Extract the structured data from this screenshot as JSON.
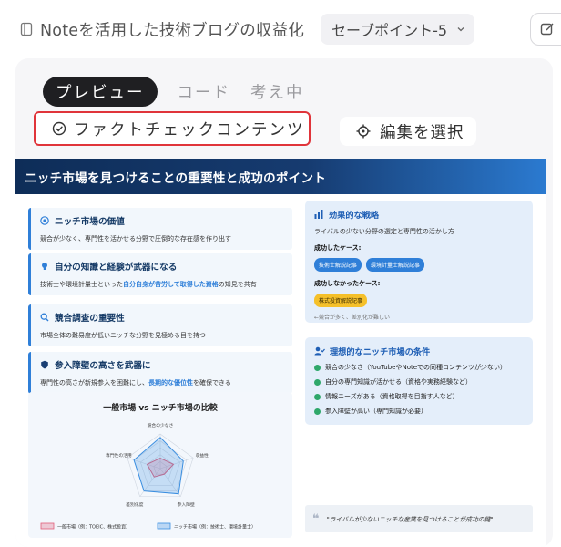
{
  "topbar": {
    "doc_title": "Noteを活用した技術ブログの収益化",
    "save_point": "セーブポイント-5"
  },
  "tabs": [
    {
      "label": "プレビュー",
      "active": true
    },
    {
      "label": "コード",
      "active": false
    },
    {
      "label": "考え中",
      "active": false
    }
  ],
  "actions": {
    "fact_check": "ファクトチェックコンテンツ",
    "select_edit": "編集を選択"
  },
  "slide": {
    "title": "ニッチ市場を見つけることの重要性と成功のポイント",
    "cards": [
      {
        "title": "ニッチ市場の価値",
        "text": "競合が少なく、専門性を活かせる分野で圧倒的な存在感を作り出す"
      },
      {
        "title": "自分の知識と経験が武器になる",
        "text_before": "技術士や環境計量士といった",
        "text_highlight": "自分自身が苦労して取得した資格",
        "text_after": "の知見を共有"
      },
      {
        "title": "競合調査の重要性",
        "text": "市場全体の難易度が低いニッチな分野を見極める目を持つ"
      },
      {
        "title": "参入障壁の高さを武器に",
        "text_before": "専門性の高さが新規参入を困難にし、",
        "text_highlight": "長期的な優位性",
        "text_after": "を確保できる"
      }
    ],
    "strategy": {
      "title": "効果的な戦略",
      "text": "ライバルの少ない分野の選定と専門性の活かし方",
      "success_label": "成功したケース:",
      "success_chips": [
        "技術士解説記事",
        "環境計量士解説記事"
      ],
      "fail_label": "成功しなかったケース:",
      "fail_chips": [
        "株式投資解説記事"
      ],
      "fail_note": "←競合が多く、差別化が難しい"
    },
    "ideal": {
      "title": "理想的なニッチ市場の条件",
      "items": [
        "競合の少なさ（YouTubeやNoteでの同種コンテンツが少ない）",
        "自分の専門知識が活かせる（資格や実務経験など）",
        "情報ニーズがある（資格取得を目指す人など）",
        "参入障壁が高い（専門知識が必要）"
      ]
    },
    "quote": "\"ライバルが少ないニッチな産業を見つけることが成功の鍵\""
  },
  "chart_data": {
    "type": "radar",
    "title": "一般市場 vs ニッチ市場の比較",
    "axes": [
      "競合の少なさ",
      "収益性",
      "参入障壁",
      "差別化度",
      "専門性の活用"
    ],
    "max": 5,
    "series": [
      {
        "name": "一般市場（例：TOEIC、株式投資）",
        "values": [
          1.5,
          2,
          1,
          1.5,
          2
        ],
        "color": "#e0607a"
      },
      {
        "name": "ニッチ市場（例：技術士、環境計量士）",
        "values": [
          4.5,
          3.5,
          4.5,
          4,
          4
        ],
        "color": "#3a8ee0"
      }
    ]
  }
}
